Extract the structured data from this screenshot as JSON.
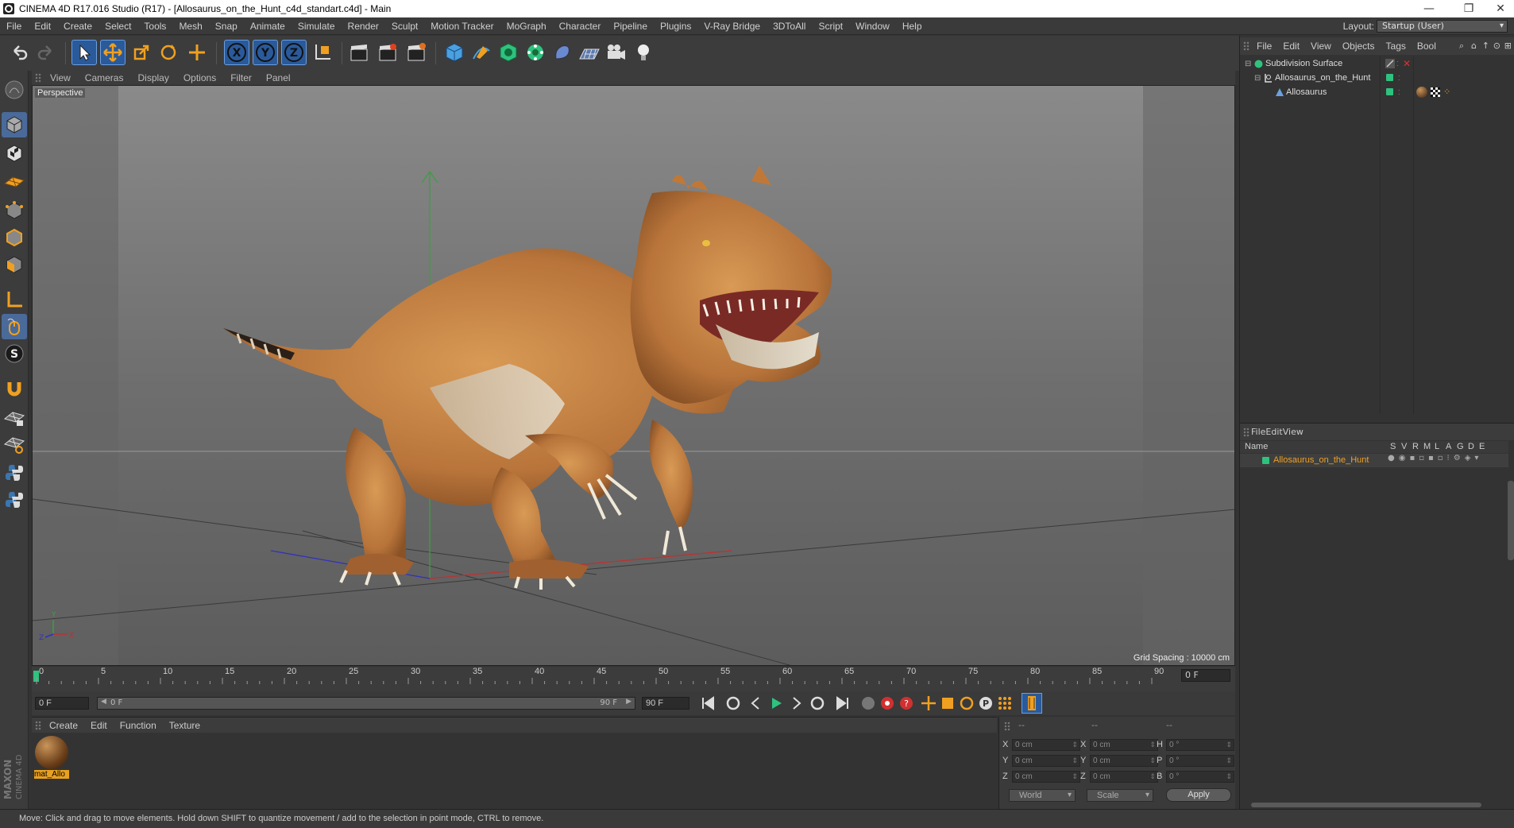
{
  "window": {
    "title": "CINEMA 4D R17.016 Studio (R17) - [Allosaurus_on_the_Hunt_c4d_standart.c4d] - Main"
  },
  "menu": [
    "File",
    "Edit",
    "Create",
    "Select",
    "Tools",
    "Mesh",
    "Snap",
    "Animate",
    "Simulate",
    "Render",
    "Sculpt",
    "Motion Tracker",
    "MoGraph",
    "Character",
    "Pipeline",
    "Plugins",
    "V-Ray Bridge",
    "3DToAll",
    "Script",
    "Window",
    "Help"
  ],
  "layout": {
    "label": "Layout:",
    "value": "Startup (User)"
  },
  "viewport": {
    "menu": [
      "View",
      "Cameras",
      "Display",
      "Options",
      "Filter",
      "Panel"
    ],
    "label": "Perspective",
    "grid_spacing": "Grid Spacing : 10000 cm"
  },
  "timeline": {
    "ticks": [
      "0",
      "5",
      "10",
      "15",
      "20",
      "25",
      "30",
      "35",
      "40",
      "45",
      "50",
      "55",
      "60",
      "65",
      "70",
      "75",
      "80",
      "85",
      "90"
    ],
    "current_frame": "0 F",
    "start_field": "0 F",
    "range_start": "0 F",
    "range_end": "90 F",
    "end_field": "90 F"
  },
  "material_manager": {
    "menu": [
      "Create",
      "Edit",
      "Function",
      "Texture"
    ],
    "material_label": "mat_Allo"
  },
  "coordinates": {
    "headers": [
      "--",
      "--",
      "--"
    ],
    "rows": [
      {
        "a": "X",
        "a_val": "0 cm",
        "b": "X",
        "b_val": "0 cm",
        "c": "H",
        "c_val": "0 °"
      },
      {
        "a": "Y",
        "a_val": "0 cm",
        "b": "Y",
        "b_val": "0 cm",
        "c": "P",
        "c_val": "0 °"
      },
      {
        "a": "Z",
        "a_val": "0 cm",
        "b": "Z",
        "b_val": "0 cm",
        "c": "B",
        "c_val": "0 °"
      }
    ],
    "mode": "World",
    "scale": "Scale",
    "apply": "Apply"
  },
  "object_manager": {
    "menu": [
      "File",
      "Edit",
      "View",
      "Objects",
      "Tags",
      "Bool"
    ],
    "objects": [
      "Subdivision Surface",
      "Allosaurus_on_the_Hunt",
      "Allosaurus"
    ]
  },
  "layer_manager": {
    "menu": [
      "File",
      "Edit",
      "View"
    ],
    "columns": [
      "Name",
      "S",
      "V",
      "R",
      "M",
      "L",
      "A",
      "G",
      "D",
      "E"
    ],
    "layer": "Allosaurus_on_the_Hunt"
  },
  "statusbar": "Move: Click and drag to move elements. Hold down SHIFT to quantize movement / add to the selection in point mode, CTRL to remove.",
  "colors": {
    "accent_blue": "#2a5a9a",
    "layer_orange": "#f0a020",
    "green_tag": "#2ec27e"
  }
}
